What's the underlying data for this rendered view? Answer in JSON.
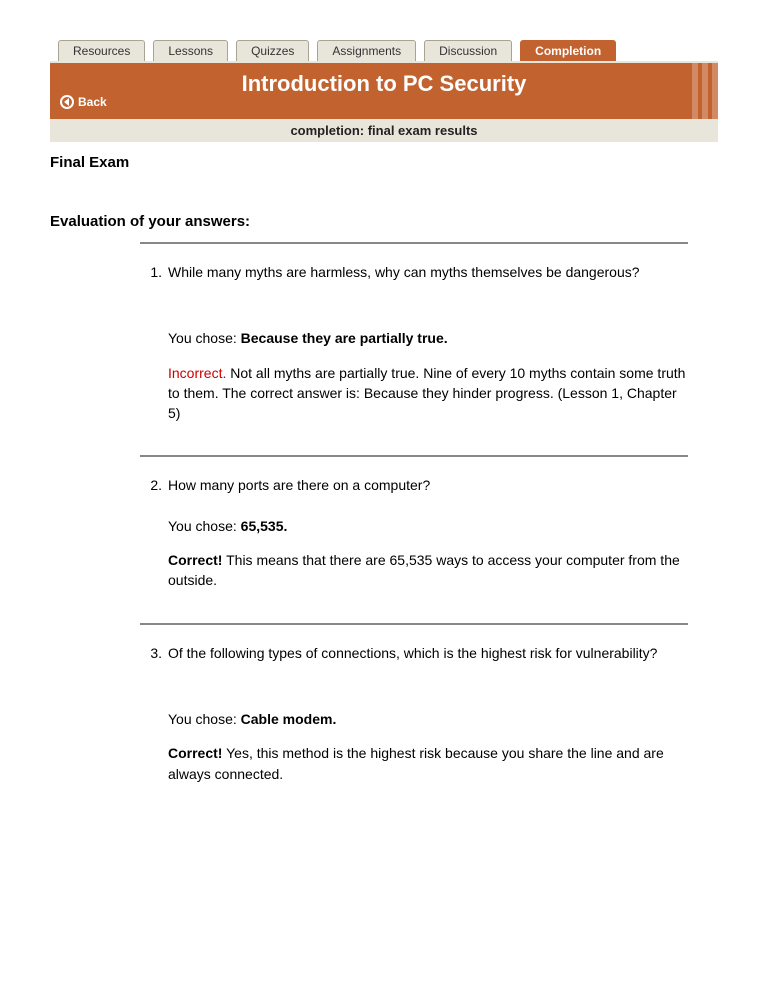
{
  "tabs": [
    {
      "label": "Resources",
      "active": false
    },
    {
      "label": "Lessons",
      "active": false
    },
    {
      "label": "Quizzes",
      "active": false
    },
    {
      "label": "Assignments",
      "active": false
    },
    {
      "label": "Discussion",
      "active": false
    },
    {
      "label": "Completion",
      "active": true
    }
  ],
  "header": {
    "back_label": "Back",
    "title": "Introduction to PC Security",
    "subtitle": "completion: final exam results"
  },
  "body": {
    "section_title": "Final Exam",
    "eval_title": "Evaluation of your answers:"
  },
  "questions": [
    {
      "num": "1.",
      "text": "While many myths are harmless, why can myths themselves be dangerous?",
      "chose_prefix": "You chose: ",
      "chose_value": "Because they are partially true.",
      "result_label": "Incorrect.",
      "result_text": " Not all myths are partially true. Nine of every 10 myths contain some truth to them. The correct answer is: Because they hinder progress. (Lesson 1, Chapter 5)",
      "correct": false,
      "extra_gap_before_choice": true
    },
    {
      "num": "2.",
      "text": "How many ports are there on a computer?",
      "chose_prefix": "You chose: ",
      "chose_value": "65,535.",
      "result_label": "Correct!",
      "result_text": " This means that there are 65,535 ways to access your computer from the outside.",
      "correct": true,
      "extra_gap_before_choice": false
    },
    {
      "num": "3.",
      "text": "Of the following types of connections, which is the highest risk for vulnerability?",
      "chose_prefix": "You chose: ",
      "chose_value": "Cable modem.",
      "result_label": "Correct!",
      "result_text": " Yes, this method is the highest risk because you share the line and are always connected.",
      "correct": true,
      "extra_gap_before_choice": true
    }
  ]
}
